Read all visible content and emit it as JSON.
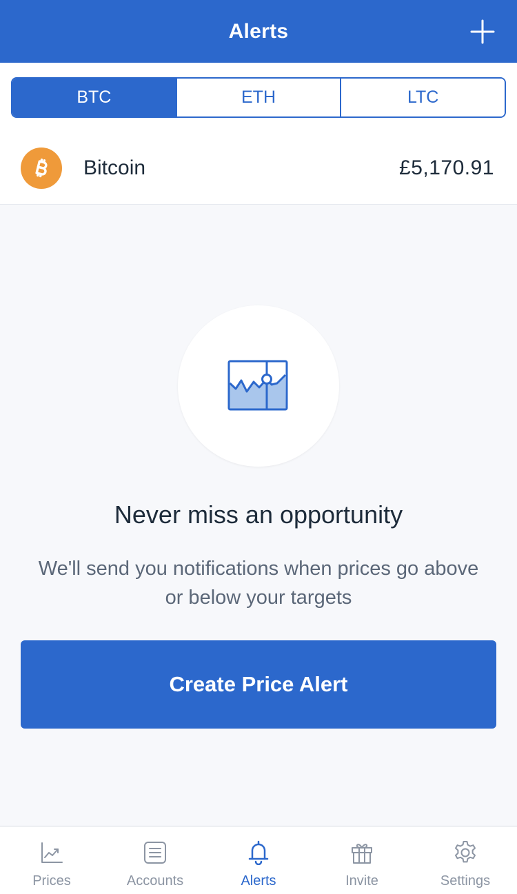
{
  "header": {
    "title": "Alerts",
    "add_icon": "plus-icon"
  },
  "segments": [
    {
      "label": "BTC",
      "active": true
    },
    {
      "label": "ETH",
      "active": false
    },
    {
      "label": "LTC",
      "active": false
    }
  ],
  "coin": {
    "name": "Bitcoin",
    "price": "£5,170.91",
    "icon": "bitcoin-icon",
    "icon_color": "#ef9a3a"
  },
  "empty_state": {
    "icon": "price-chart-icon",
    "title": "Never miss an opportunity",
    "description": "We'll send you notifications when prices go above or below your targets",
    "cta_label": "Create Price Alert"
  },
  "tabbar": {
    "items": [
      {
        "label": "Prices",
        "icon": "chart-icon",
        "active": false
      },
      {
        "label": "Accounts",
        "icon": "document-icon",
        "active": false
      },
      {
        "label": "Alerts",
        "icon": "bell-icon",
        "active": true
      },
      {
        "label": "Invite",
        "icon": "gift-icon",
        "active": false
      },
      {
        "label": "Settings",
        "icon": "gear-icon",
        "active": false
      }
    ]
  },
  "colors": {
    "primary": "#2c68cc",
    "text": "#1d2b3a",
    "muted": "#8c95a3",
    "background": "#f7f8fb"
  }
}
